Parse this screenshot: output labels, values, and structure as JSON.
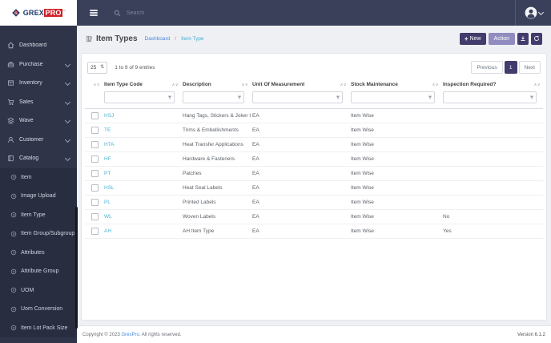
{
  "brand": {
    "name_primary": "GREX",
    "name_secondary": "PRO",
    "trademark": "™"
  },
  "topbar": {
    "search_placeholder": "Search"
  },
  "sidebar": {
    "items": [
      {
        "label": "Dashboard",
        "icon": "home",
        "expandable": false
      },
      {
        "label": "Purchase",
        "icon": "briefcase",
        "expandable": true
      },
      {
        "label": "Inventory",
        "icon": "box",
        "expandable": true
      },
      {
        "label": "Sales",
        "icon": "cart",
        "expandable": true
      },
      {
        "label": "Wave",
        "icon": "layers",
        "expandable": true
      },
      {
        "label": "Customer",
        "icon": "user",
        "expandable": true
      },
      {
        "label": "Catalog",
        "icon": "book",
        "expandable": true
      }
    ],
    "submenu": [
      "Item",
      "Image Upload",
      "Item Type",
      "Item Group/Subgroup",
      "Attributes",
      "Attribute Group",
      "UOM",
      "Uom Conversion",
      "Item Lot Pack Size"
    ],
    "submenu_icon": "circle-arrow",
    "active_submenu_item": "Item Type"
  },
  "page": {
    "title": "Item Types",
    "title_icon": "books",
    "breadcrumb": {
      "parent": "Dashboard",
      "separator": "/",
      "current": "Item Type"
    },
    "buttons": {
      "new_icon": "+",
      "new": "New",
      "action": "Action",
      "download_icon": "download",
      "refresh_icon": "refresh"
    }
  },
  "table": {
    "page_size": "25",
    "entries_info": "1 to 9 of 9 entries",
    "pagination": {
      "previous": "Previous",
      "current": "1",
      "next": "Next"
    },
    "columns": [
      "Item Type Code",
      "Description",
      "Unit Of Measurement",
      "Stock Maintenance",
      "Inspection Required?"
    ],
    "rows": [
      {
        "code": "HSJ",
        "description": "Hang Tags, Stickers & Joker tags",
        "uom": "EA",
        "stock": "Item Wise",
        "inspection": ""
      },
      {
        "code": "TE",
        "description": "Trims & Embellishments",
        "uom": "EA",
        "stock": "Item Wise",
        "inspection": ""
      },
      {
        "code": "HTA",
        "description": "Heat Transfer Applications",
        "uom": "EA",
        "stock": "Item Wise",
        "inspection": ""
      },
      {
        "code": "HF",
        "description": "Hardware & Fasteners",
        "uom": "EA",
        "stock": "Item Wise",
        "inspection": ""
      },
      {
        "code": "PT",
        "description": "Patches",
        "uom": "EA",
        "stock": "Item Wise",
        "inspection": ""
      },
      {
        "code": "HSL",
        "description": "Heat Seal Labels",
        "uom": "EA",
        "stock": "Item Wise",
        "inspection": ""
      },
      {
        "code": "PL",
        "description": "Printed Labels",
        "uom": "EA",
        "stock": "Item Wise",
        "inspection": ""
      },
      {
        "code": "WL",
        "description": "Woven Labels",
        "uom": "EA",
        "stock": "Item Wise",
        "inspection": "No"
      },
      {
        "code": "AH",
        "description": "AH Item Type",
        "uom": "EA",
        "stock": "Item Wise",
        "inspection": "Yes"
      }
    ]
  },
  "footer": {
    "copyright_prefix": "Copyright © 2023 ",
    "brand": "GrexPro.",
    "copyright_suffix": " All rights reserved.",
    "version": "Version 6.1.2"
  },
  "colors": {
    "accent": "#413c6b",
    "accent_light": "#908cc0",
    "brand_red": "#d22027",
    "brand_navy": "#1e3a6e",
    "link_blue": "#4a89dc",
    "link_teal": "#45b0d5",
    "code_link": "#4db3d6",
    "topbar_bg": "#3a4059",
    "sidebar_bg": "#2f3449",
    "submenu_bg": "#282d40"
  }
}
